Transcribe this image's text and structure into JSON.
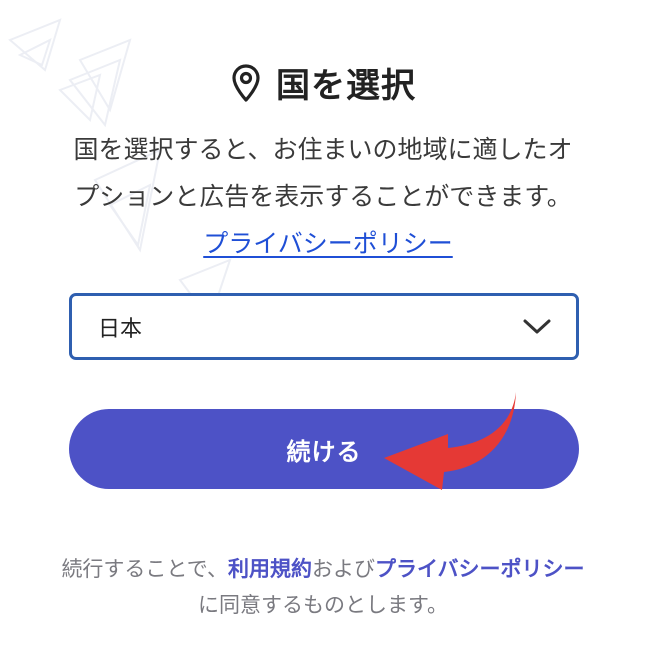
{
  "header": {
    "icon": "location-pin-icon",
    "title": "国を選択"
  },
  "description": {
    "text": "国を選択すると、お住まいの地域に適したオプションと広告を表示することができます。",
    "privacy_link": "プライバシーポリシー"
  },
  "country_select": {
    "value": "日本",
    "icon": "chevron-down-icon"
  },
  "continue_button": {
    "label": "続ける",
    "color": "#4d52c6"
  },
  "annotation": {
    "icon": "red-curved-arrow-icon",
    "color": "#e53935"
  },
  "footer": {
    "prefix": "続行することで、",
    "terms_link": "利用規約",
    "and": "および",
    "privacy_link": "プライバシーポリシー",
    "suffix": "に同意するものとします。"
  },
  "colors": {
    "accent": "#4d52c6",
    "link": "#1f4fd6",
    "select_border": "#2f5fb0"
  }
}
